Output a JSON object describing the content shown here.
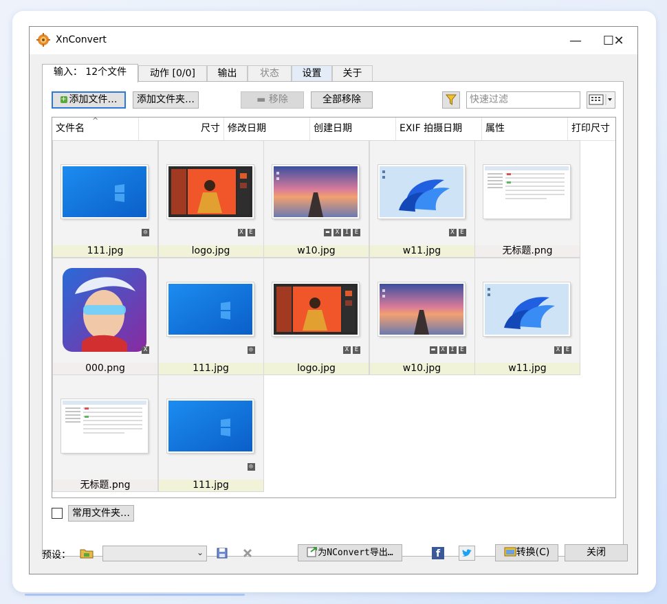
{
  "app": {
    "title": "XnConvert"
  },
  "window_controls": {
    "minimize": "—",
    "maximize": "☐",
    "close": "✕"
  },
  "tabs": [
    {
      "label": "输入： 12个文件",
      "state": "active"
    },
    {
      "label": "动作 [0/0]",
      "state": "normal"
    },
    {
      "label": "输出",
      "state": "normal"
    },
    {
      "label": "状态",
      "state": "disabled"
    },
    {
      "label": "设置",
      "state": "highlight"
    },
    {
      "label": "关于",
      "state": "normal"
    }
  ],
  "toolbar": {
    "add_files": "添加文件…",
    "add_folder": "添加文件夹…",
    "remove": "移除",
    "remove_all": "全部移除",
    "filter_placeholder": "快速过滤"
  },
  "columns": [
    "文件名",
    "尺寸",
    "修改日期",
    "创建日期",
    "EXIF 拍摄日期",
    "属性",
    "打印尺寸"
  ],
  "files": [
    {
      "name": "111.jpg",
      "thumb": "win10",
      "badges": [
        "◎"
      ],
      "caption": "yellow"
    },
    {
      "name": "logo.jpg",
      "thumb": "logo",
      "badges": [
        "X",
        "E"
      ],
      "caption": "yellow"
    },
    {
      "name": "w10.jpg",
      "thumb": "pier",
      "badges": [
        "▬",
        "X",
        "I",
        "E"
      ],
      "caption": "yellow"
    },
    {
      "name": "w11.jpg",
      "thumb": "win11",
      "badges": [
        "X",
        "E"
      ],
      "caption": "yellow"
    },
    {
      "name": "无标题.png",
      "thumb": "doc",
      "badges": [],
      "caption": "pink"
    },
    {
      "name": "000.png",
      "thumb": "avatar",
      "badges": [
        "X"
      ],
      "caption": "pink"
    },
    {
      "name": "111.jpg",
      "thumb": "win10",
      "badges": [
        "◎"
      ],
      "caption": "yellow"
    },
    {
      "name": "logo.jpg",
      "thumb": "logo",
      "badges": [
        "X",
        "E"
      ],
      "caption": "yellow"
    },
    {
      "name": "w10.jpg",
      "thumb": "pier",
      "badges": [
        "▬",
        "X",
        "I",
        "E"
      ],
      "caption": "yellow"
    },
    {
      "name": "w11.jpg",
      "thumb": "win11",
      "badges": [
        "X",
        "E"
      ],
      "caption": "yellow"
    },
    {
      "name": "无标题.png",
      "thumb": "doc",
      "badges": [],
      "caption": "pink"
    },
    {
      "name": "111.jpg",
      "thumb": "win10",
      "badges": [
        "◎"
      ],
      "caption": "yellow"
    }
  ],
  "favorites": {
    "label": "常用文件夹…",
    "checked": false
  },
  "bottom": {
    "preset_label": "预设：",
    "preset_value": "",
    "export_label": "为NConvert导出…",
    "convert_label": "转换(C)",
    "close_label": "关闭"
  },
  "colors": {
    "accent": "#2b78d6",
    "caption_yellow": "#f1f3d9",
    "caption_pink": "#f3eeee",
    "win_blue": "#0a78d8"
  },
  "icons": {
    "app": "xnconvert-gear-icon",
    "add": "plus-icon",
    "remove": "minus-icon",
    "filter": "funnel-icon",
    "view": "grid-view-icon",
    "preset_folder": "folder-icon",
    "save": "save-icon",
    "delete": "delete-icon",
    "facebook": "facebook-icon",
    "twitter": "twitter-icon",
    "convert": "convert-icon"
  }
}
